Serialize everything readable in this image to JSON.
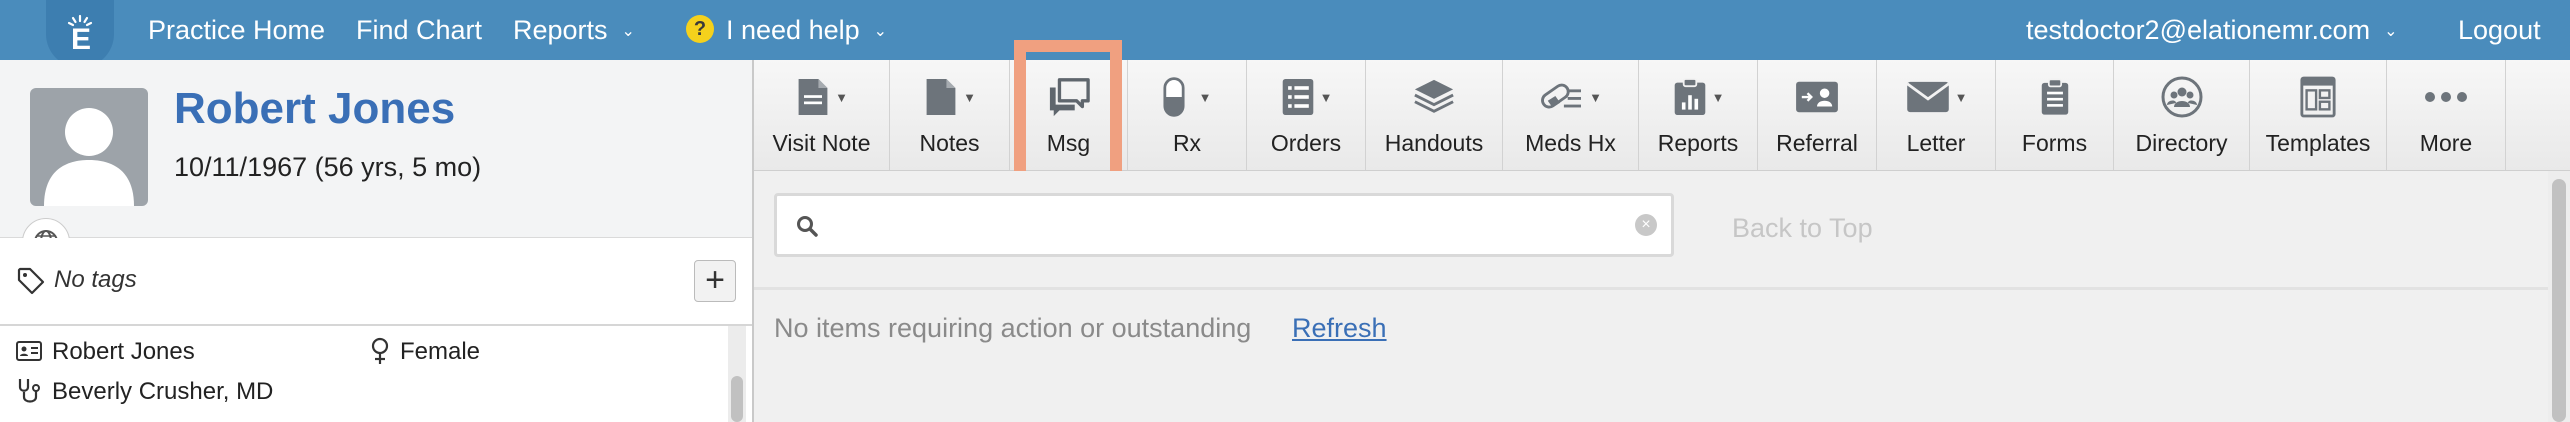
{
  "nav": {
    "practice_home": "Practice Home",
    "find_chart": "Find Chart",
    "reports": "Reports",
    "help": "I need help",
    "user": "testdoctor2@elationemr.com",
    "logout": "Logout"
  },
  "patient": {
    "name": "Robert Jones",
    "dob": "10/11/1967 (56 yrs, 5 mo)",
    "tags": "No tags",
    "info_name": "Robert Jones",
    "sex": "Female",
    "provider": "Beverly Crusher, MD"
  },
  "toolbar": {
    "visit_note": "Visit Note",
    "notes": "Notes",
    "msg": "Msg",
    "rx": "Rx",
    "orders": "Orders",
    "handouts": "Handouts",
    "meds_hx": "Meds Hx",
    "reports": "Reports",
    "referral": "Referral",
    "letter": "Letter",
    "forms": "Forms",
    "directory": "Directory",
    "templates": "Templates",
    "more": "More"
  },
  "content": {
    "search_placeholder": "",
    "back_to_top": "Back to Top",
    "empty_message": "No items requiring action or outstanding",
    "refresh": "Refresh"
  },
  "colors": {
    "nav_bg": "#4a8cbc",
    "patient_name": "#3a6fb6",
    "highlight": "#f0a080"
  }
}
